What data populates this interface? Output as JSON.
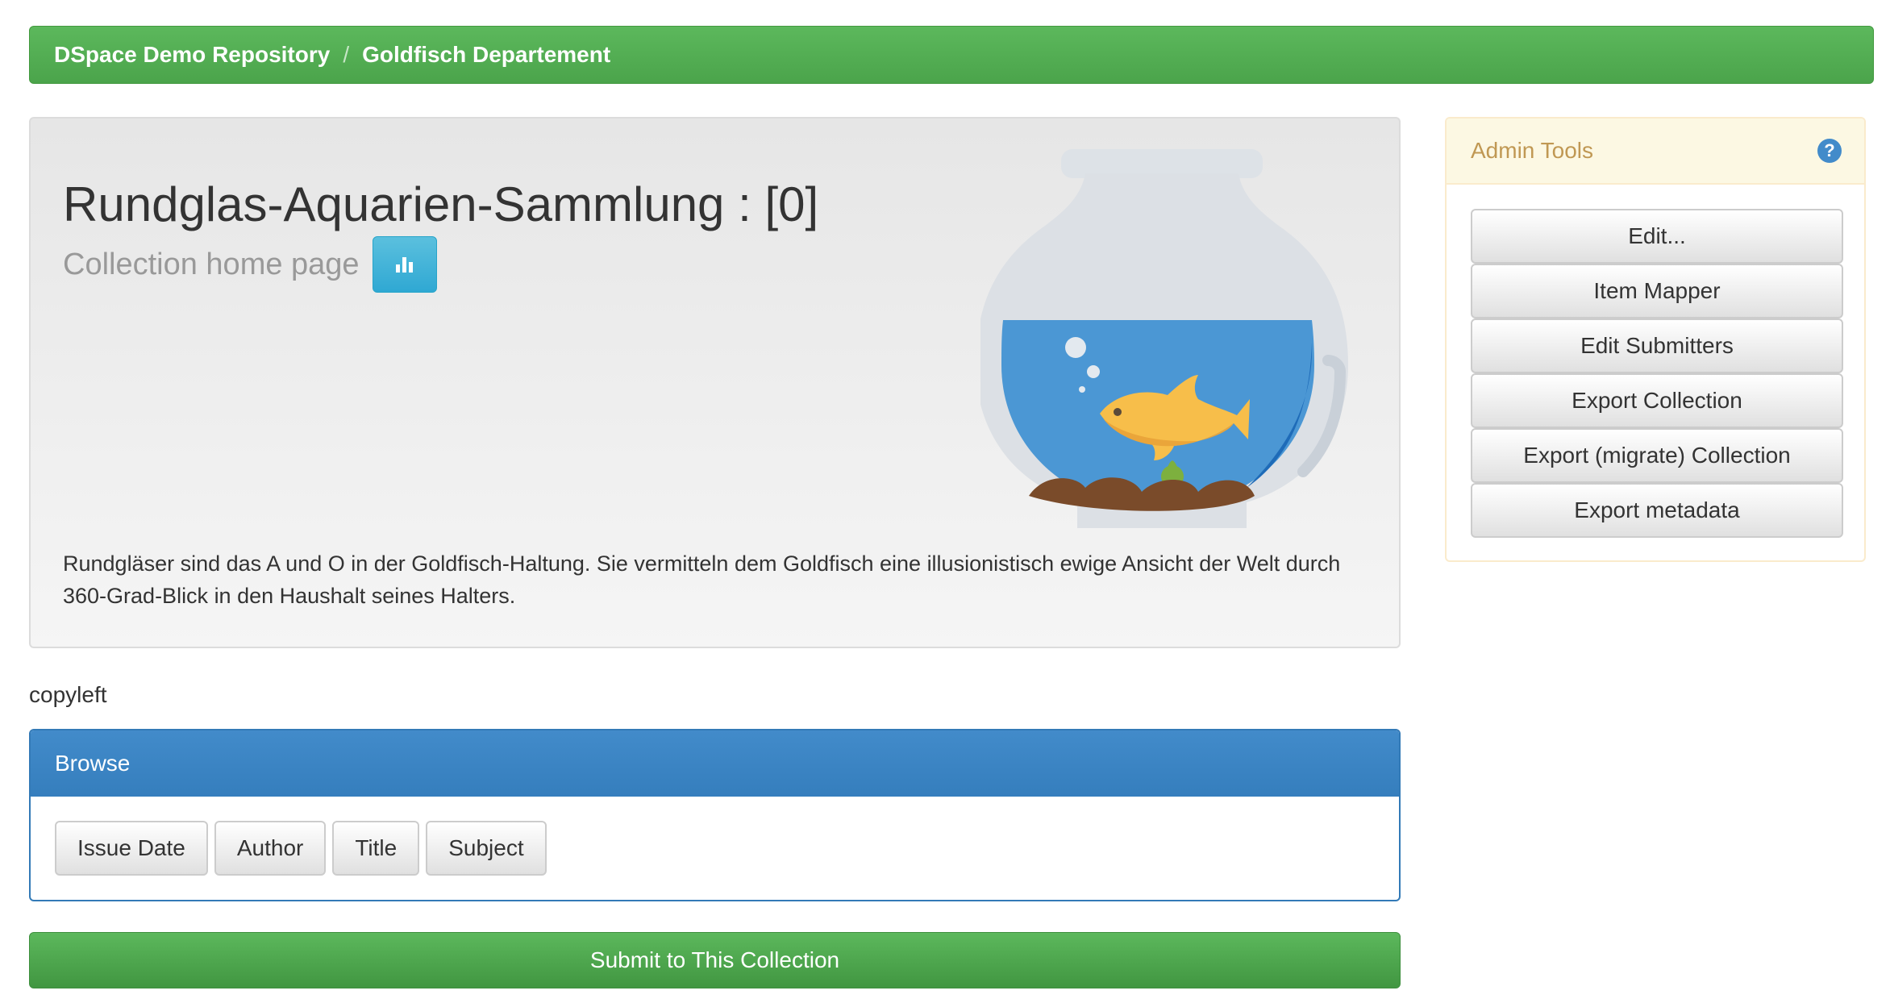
{
  "breadcrumb": {
    "items": [
      "DSpace Demo Repository",
      "Goldfisch Departement"
    ],
    "separator": "/"
  },
  "collection": {
    "title": "Rundglas-Aquarien-Sammlung : [0]",
    "subtitle": "Collection home page",
    "stats_icon": "bar-chart-icon",
    "image_icon": "goldfish-bowl",
    "description": "Rundgläser sind das A und O in der Goldfisch-Haltung. Sie vermitteln dem Goldfisch eine illusionistisch ewige Ansicht der Welt durch 360-Grad-Blick in den Haushalt seines Halters.",
    "rights": "copyleft"
  },
  "browse": {
    "heading": "Browse",
    "buttons": [
      "Issue Date",
      "Author",
      "Title",
      "Subject"
    ]
  },
  "submit_label": "Submit to This Collection",
  "admin": {
    "heading": "Admin Tools",
    "help_icon": "question-circle-icon",
    "help_glyph": "?",
    "buttons": [
      "Edit...",
      "Item Mapper",
      "Edit Submitters",
      "Export Collection",
      "Export (migrate) Collection",
      "Export metadata"
    ]
  },
  "colors": {
    "success": "#5cb85c",
    "primary": "#337ab7",
    "info": "#5bc0de",
    "warning_text": "#c09853",
    "warning_bg": "#fcf8e3"
  }
}
